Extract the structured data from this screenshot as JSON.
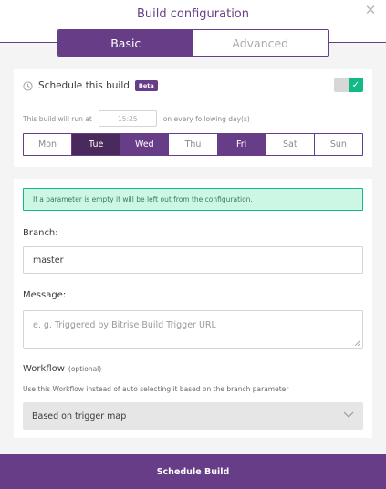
{
  "dialog": {
    "title": "Build configuration"
  },
  "tabs": [
    {
      "label": "Basic",
      "active": true
    },
    {
      "label": "Advanced",
      "active": false
    }
  ],
  "schedule": {
    "label": "Schedule this build",
    "badge": "Beta",
    "enabled": true,
    "run_prefix": "This build will run at",
    "time": "15:25",
    "run_suffix": "on every following day(s)",
    "days": [
      {
        "label": "Mon",
        "selected": false
      },
      {
        "label": "Tue",
        "selected": true
      },
      {
        "label": "Wed",
        "selected": true
      },
      {
        "label": "Thu",
        "selected": false
      },
      {
        "label": "Fri",
        "selected": true
      },
      {
        "label": "Sat",
        "selected": false
      },
      {
        "label": "Sun",
        "selected": false
      }
    ]
  },
  "form": {
    "info_message": "If a parameter is empty it will be left out from the configuration.",
    "branch_label": "Branch:",
    "branch_value": "master",
    "message_label": "Message:",
    "message_placeholder": "e. g. Triggered by Bitrise Build Trigger URL",
    "workflow_label": "Workflow",
    "workflow_optional": "(optional)",
    "workflow_hint": "Use this Workflow instead of auto selecting it based on the branch parameter",
    "workflow_value": "Based on trigger map"
  },
  "footer": {
    "button_label": "Schedule Build"
  },
  "colors": {
    "accent": "#683d87",
    "accent_dark": "#4a2a5c",
    "success": "#12b886",
    "info_bg": "#ccf7e4"
  },
  "icons": {
    "close": "close-icon",
    "clock": "clock-icon",
    "check": "check-icon",
    "chevron": "chevron-down-icon"
  }
}
